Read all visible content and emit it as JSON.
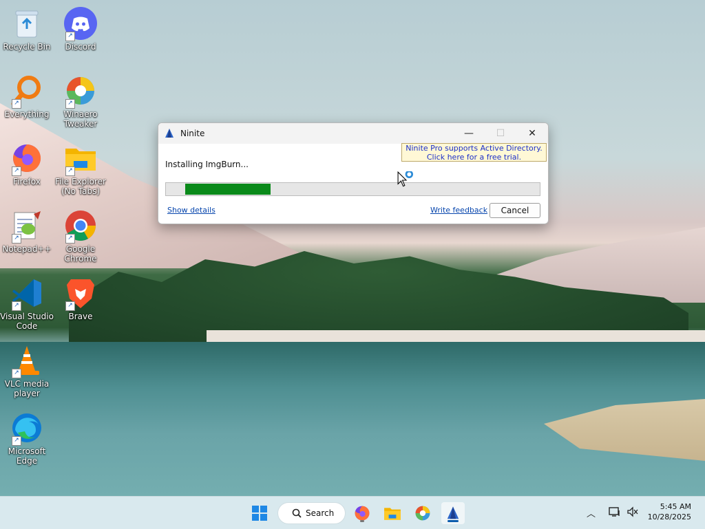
{
  "desktop": {
    "icons": [
      {
        "label": "Recycle Bin"
      },
      {
        "label": "Discord"
      },
      {
        "label": "Everything"
      },
      {
        "label": "Winaero Tweaker"
      },
      {
        "label": "Firefox"
      },
      {
        "label": "File Explorer (No Tabs)"
      },
      {
        "label": "Notepad++"
      },
      {
        "label": "Google Chrome"
      },
      {
        "label": "Visual Studio Code"
      },
      {
        "label": "Brave"
      },
      {
        "label": "VLC media player"
      },
      {
        "label": "Microsoft Edge"
      }
    ]
  },
  "window": {
    "title": "Ninite",
    "status": "Installing ImgBurn...",
    "progress_percent": 24,
    "pro_banner_line1": "Ninite Pro supports Active Directory.",
    "pro_banner_line2": "Click here for a free trial.",
    "show_details": "Show details",
    "write_feedback": "Write feedback",
    "cancel": "Cancel"
  },
  "taskbar": {
    "search_label": "Search",
    "time": "5:45 AM",
    "date": "10/28/2025"
  },
  "colors": {
    "progress": "#0a8a1a",
    "accent": "#0b5cad",
    "link": "#0645ad"
  }
}
